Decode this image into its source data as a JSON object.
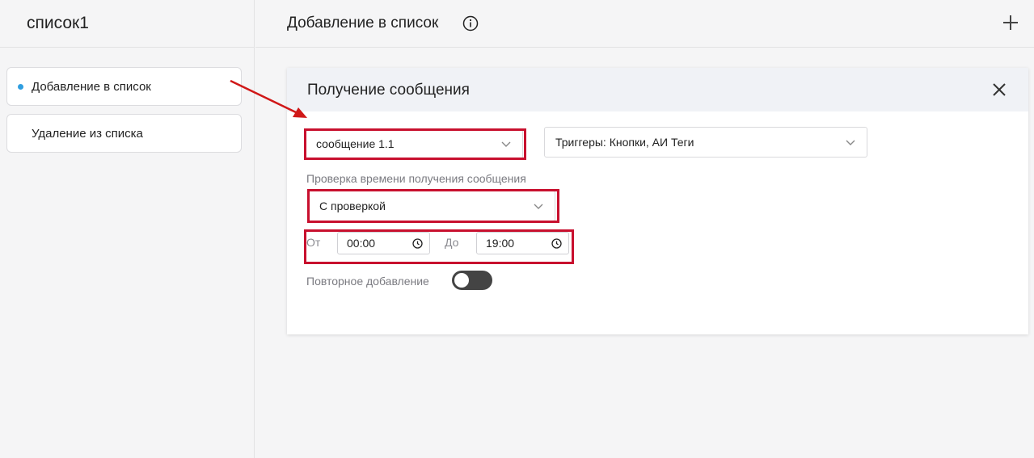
{
  "sidebar": {
    "title": "список1",
    "items": [
      {
        "label": "Добавление в список",
        "active": true
      },
      {
        "label": "Удаление из списка",
        "active": false
      }
    ]
  },
  "header": {
    "title": "Добавление в список",
    "info_icon": "info-icon",
    "add_icon": "plus-icon"
  },
  "panel": {
    "title": "Получение сообщения",
    "close_icon": "close-icon",
    "message_select": {
      "value": "сообщение 1.1"
    },
    "triggers_select": {
      "value": "Триггеры: Кнопки, АИ Теги"
    },
    "time_check_label": "Проверка времени получения сообщения",
    "time_check_select": {
      "value": "С проверкой"
    },
    "from_label": "От",
    "from_time": "00:00",
    "to_label": "До",
    "to_time": "19:00",
    "repeat_label": "Повторное добавление",
    "repeat_enabled": false
  },
  "colors": {
    "accent_dot": "#2f9ee0",
    "highlight": "#c8102e",
    "toggle_off": "#444444"
  }
}
